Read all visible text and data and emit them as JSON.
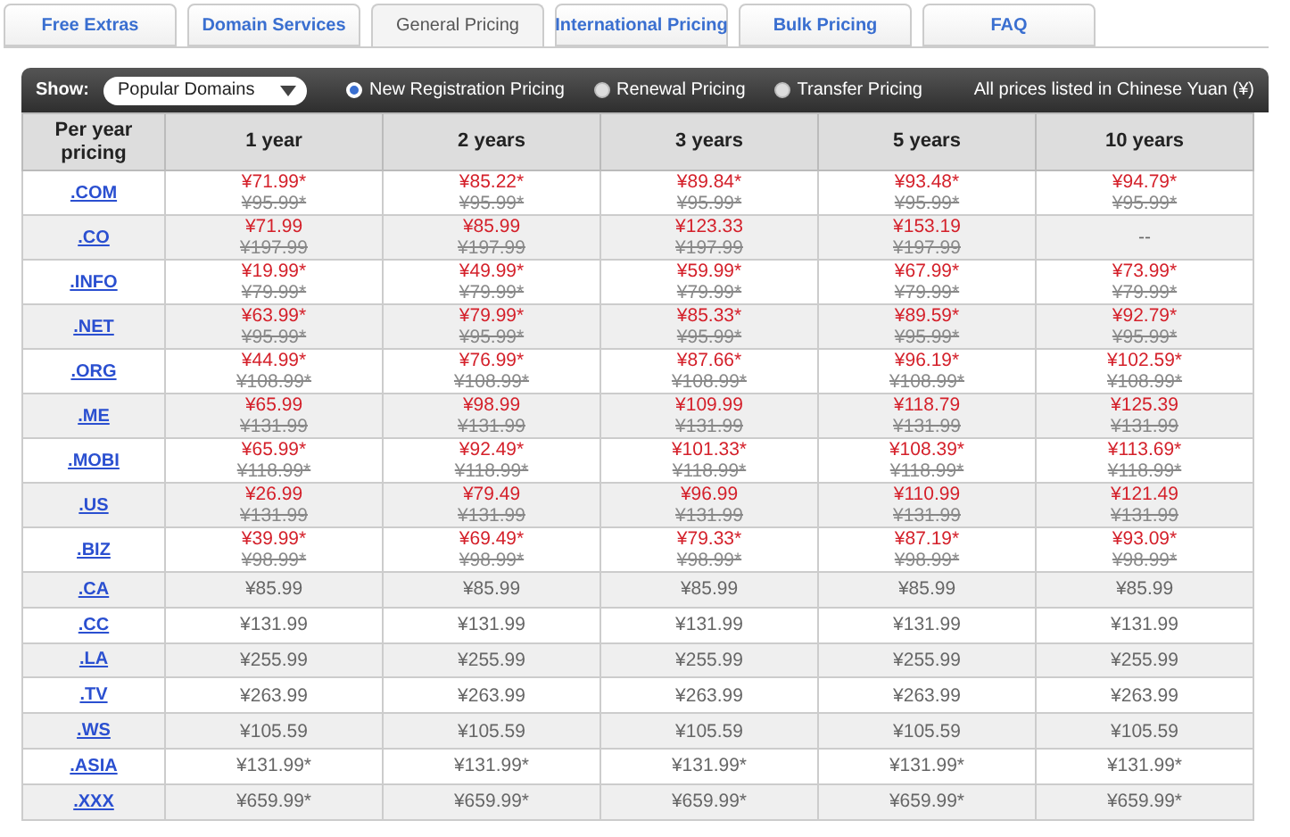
{
  "tabs": [
    {
      "label": "Free Extras",
      "selected": false
    },
    {
      "label": "Domain Services",
      "selected": false
    },
    {
      "label": "General Pricing",
      "selected": true
    },
    {
      "label": "International Pricing",
      "selected": false
    },
    {
      "label": "Bulk Pricing",
      "selected": false
    },
    {
      "label": "FAQ",
      "selected": false
    }
  ],
  "toolbar": {
    "show_label": "Show:",
    "dropdown": "Popular Domains",
    "radios": [
      {
        "label": "New Registration Pricing",
        "selected": true
      },
      {
        "label": "Renewal Pricing",
        "selected": false
      },
      {
        "label": "Transfer Pricing",
        "selected": false
      }
    ],
    "note": "All prices listed in Chinese Yuan (¥)"
  },
  "table": {
    "corner": "Per year pricing",
    "columns": [
      "1 year",
      "2 years",
      "3 years",
      "5 years",
      "10 years"
    ],
    "rows": [
      {
        "domain": ".COM",
        "cells": [
          {
            "kind": "sale",
            "price": "¥71.99*",
            "old": "¥95.99*"
          },
          {
            "kind": "sale",
            "price": "¥85.22*",
            "old": "¥95.99*"
          },
          {
            "kind": "sale",
            "price": "¥89.84*",
            "old": "¥95.99*"
          },
          {
            "kind": "sale",
            "price": "¥93.48*",
            "old": "¥95.99*"
          },
          {
            "kind": "sale",
            "price": "¥94.79*",
            "old": "¥95.99*"
          }
        ]
      },
      {
        "domain": ".CO",
        "cells": [
          {
            "kind": "sale",
            "price": "¥71.99",
            "old": "¥197.99"
          },
          {
            "kind": "sale",
            "price": "¥85.99",
            "old": "¥197.99"
          },
          {
            "kind": "sale",
            "price": "¥123.33",
            "old": "¥197.99"
          },
          {
            "kind": "sale",
            "price": "¥153.19",
            "old": "¥197.99"
          },
          {
            "kind": "empty",
            "price": "--"
          }
        ]
      },
      {
        "domain": ".INFO",
        "cells": [
          {
            "kind": "sale",
            "price": "¥19.99*",
            "old": "¥79.99*"
          },
          {
            "kind": "sale",
            "price": "¥49.99*",
            "old": "¥79.99*"
          },
          {
            "kind": "sale",
            "price": "¥59.99*",
            "old": "¥79.99*"
          },
          {
            "kind": "sale",
            "price": "¥67.99*",
            "old": "¥79.99*"
          },
          {
            "kind": "sale",
            "price": "¥73.99*",
            "old": "¥79.99*"
          }
        ]
      },
      {
        "domain": ".NET",
        "cells": [
          {
            "kind": "sale",
            "price": "¥63.99*",
            "old": "¥95.99*"
          },
          {
            "kind": "sale",
            "price": "¥79.99*",
            "old": "¥95.99*"
          },
          {
            "kind": "sale",
            "price": "¥85.33*",
            "old": "¥95.99*"
          },
          {
            "kind": "sale",
            "price": "¥89.59*",
            "old": "¥95.99*"
          },
          {
            "kind": "sale",
            "price": "¥92.79*",
            "old": "¥95.99*"
          }
        ]
      },
      {
        "domain": ".ORG",
        "cells": [
          {
            "kind": "sale",
            "price": "¥44.99*",
            "old": "¥108.99*"
          },
          {
            "kind": "sale",
            "price": "¥76.99*",
            "old": "¥108.99*"
          },
          {
            "kind": "sale",
            "price": "¥87.66*",
            "old": "¥108.99*"
          },
          {
            "kind": "sale",
            "price": "¥96.19*",
            "old": "¥108.99*"
          },
          {
            "kind": "sale",
            "price": "¥102.59*",
            "old": "¥108.99*"
          }
        ]
      },
      {
        "domain": ".ME",
        "cells": [
          {
            "kind": "sale",
            "price": "¥65.99",
            "old": "¥131.99"
          },
          {
            "kind": "sale",
            "price": "¥98.99",
            "old": "¥131.99"
          },
          {
            "kind": "sale",
            "price": "¥109.99",
            "old": "¥131.99"
          },
          {
            "kind": "sale",
            "price": "¥118.79",
            "old": "¥131.99"
          },
          {
            "kind": "sale",
            "price": "¥125.39",
            "old": "¥131.99"
          }
        ]
      },
      {
        "domain": ".MOBI",
        "cells": [
          {
            "kind": "sale",
            "price": "¥65.99*",
            "old": "¥118.99*"
          },
          {
            "kind": "sale",
            "price": "¥92.49*",
            "old": "¥118.99*"
          },
          {
            "kind": "sale",
            "price": "¥101.33*",
            "old": "¥118.99*"
          },
          {
            "kind": "sale",
            "price": "¥108.39*",
            "old": "¥118.99*"
          },
          {
            "kind": "sale",
            "price": "¥113.69*",
            "old": "¥118.99*"
          }
        ]
      },
      {
        "domain": ".US",
        "cells": [
          {
            "kind": "sale",
            "price": "¥26.99",
            "old": "¥131.99"
          },
          {
            "kind": "sale",
            "price": "¥79.49",
            "old": "¥131.99"
          },
          {
            "kind": "sale",
            "price": "¥96.99",
            "old": "¥131.99"
          },
          {
            "kind": "sale",
            "price": "¥110.99",
            "old": "¥131.99"
          },
          {
            "kind": "sale",
            "price": "¥121.49",
            "old": "¥131.99"
          }
        ]
      },
      {
        "domain": ".BIZ",
        "cells": [
          {
            "kind": "sale",
            "price": "¥39.99*",
            "old": "¥98.99*"
          },
          {
            "kind": "sale",
            "price": "¥69.49*",
            "old": "¥98.99*"
          },
          {
            "kind": "sale",
            "price": "¥79.33*",
            "old": "¥98.99*"
          },
          {
            "kind": "sale",
            "price": "¥87.19*",
            "old": "¥98.99*"
          },
          {
            "kind": "sale",
            "price": "¥93.09*",
            "old": "¥98.99*"
          }
        ]
      },
      {
        "domain": ".CA",
        "cells": [
          {
            "kind": "plain",
            "price": "¥85.99"
          },
          {
            "kind": "plain",
            "price": "¥85.99"
          },
          {
            "kind": "plain",
            "price": "¥85.99"
          },
          {
            "kind": "plain",
            "price": "¥85.99"
          },
          {
            "kind": "plain",
            "price": "¥85.99"
          }
        ]
      },
      {
        "domain": ".CC",
        "cells": [
          {
            "kind": "plain",
            "price": "¥131.99"
          },
          {
            "kind": "plain",
            "price": "¥131.99"
          },
          {
            "kind": "plain",
            "price": "¥131.99"
          },
          {
            "kind": "plain",
            "price": "¥131.99"
          },
          {
            "kind": "plain",
            "price": "¥131.99"
          }
        ]
      },
      {
        "domain": ".LA",
        "cells": [
          {
            "kind": "plain",
            "price": "¥255.99"
          },
          {
            "kind": "plain",
            "price": "¥255.99"
          },
          {
            "kind": "plain",
            "price": "¥255.99"
          },
          {
            "kind": "plain",
            "price": "¥255.99"
          },
          {
            "kind": "plain",
            "price": "¥255.99"
          }
        ]
      },
      {
        "domain": ".TV",
        "cells": [
          {
            "kind": "plain",
            "price": "¥263.99"
          },
          {
            "kind": "plain",
            "price": "¥263.99"
          },
          {
            "kind": "plain",
            "price": "¥263.99"
          },
          {
            "kind": "plain",
            "price": "¥263.99"
          },
          {
            "kind": "plain",
            "price": "¥263.99"
          }
        ]
      },
      {
        "domain": ".WS",
        "cells": [
          {
            "kind": "plain",
            "price": "¥105.59"
          },
          {
            "kind": "plain",
            "price": "¥105.59"
          },
          {
            "kind": "plain",
            "price": "¥105.59"
          },
          {
            "kind": "plain",
            "price": "¥105.59"
          },
          {
            "kind": "plain",
            "price": "¥105.59"
          }
        ]
      },
      {
        "domain": ".ASIA",
        "cells": [
          {
            "kind": "plain",
            "price": "¥131.99*"
          },
          {
            "kind": "plain",
            "price": "¥131.99*"
          },
          {
            "kind": "plain",
            "price": "¥131.99*"
          },
          {
            "kind": "plain",
            "price": "¥131.99*"
          },
          {
            "kind": "plain",
            "price": "¥131.99*"
          }
        ]
      },
      {
        "domain": ".XXX",
        "cells": [
          {
            "kind": "plain",
            "price": "¥659.99*"
          },
          {
            "kind": "plain",
            "price": "¥659.99*"
          },
          {
            "kind": "plain",
            "price": "¥659.99*"
          },
          {
            "kind": "plain",
            "price": "¥659.99*"
          },
          {
            "kind": "plain",
            "price": "¥659.99*"
          }
        ]
      }
    ]
  }
}
